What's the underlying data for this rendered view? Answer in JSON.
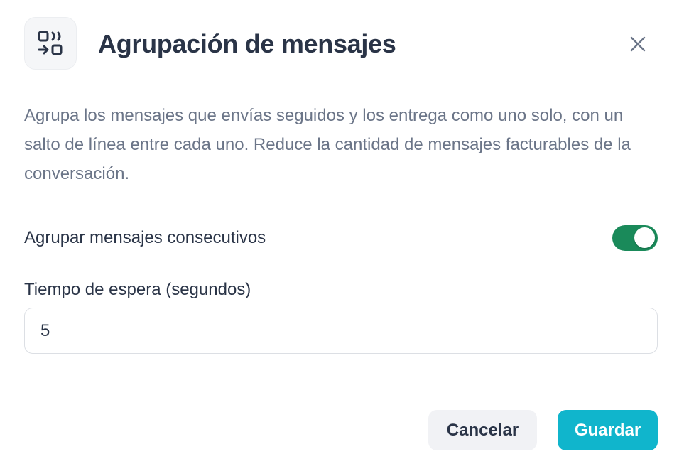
{
  "dialog": {
    "title": "Agrupación de mensajes",
    "header_icon": "message-grouping-icon",
    "close_icon": "close-icon",
    "description": "Agrupa los mensajes que envías seguidos y los entrega como uno solo, con un salto de línea entre cada uno. Reduce la cantidad de mensajes facturables de la conversación.",
    "toggle": {
      "label": "Agrupar mensajes consecutivos",
      "enabled": true,
      "color": "#1a8a5a"
    },
    "wait_time": {
      "label": "Tiempo de espera (segundos)",
      "value": "5"
    },
    "buttons": {
      "cancel": "Cancelar",
      "save": "Guardar",
      "save_color": "#10b5cc"
    }
  }
}
